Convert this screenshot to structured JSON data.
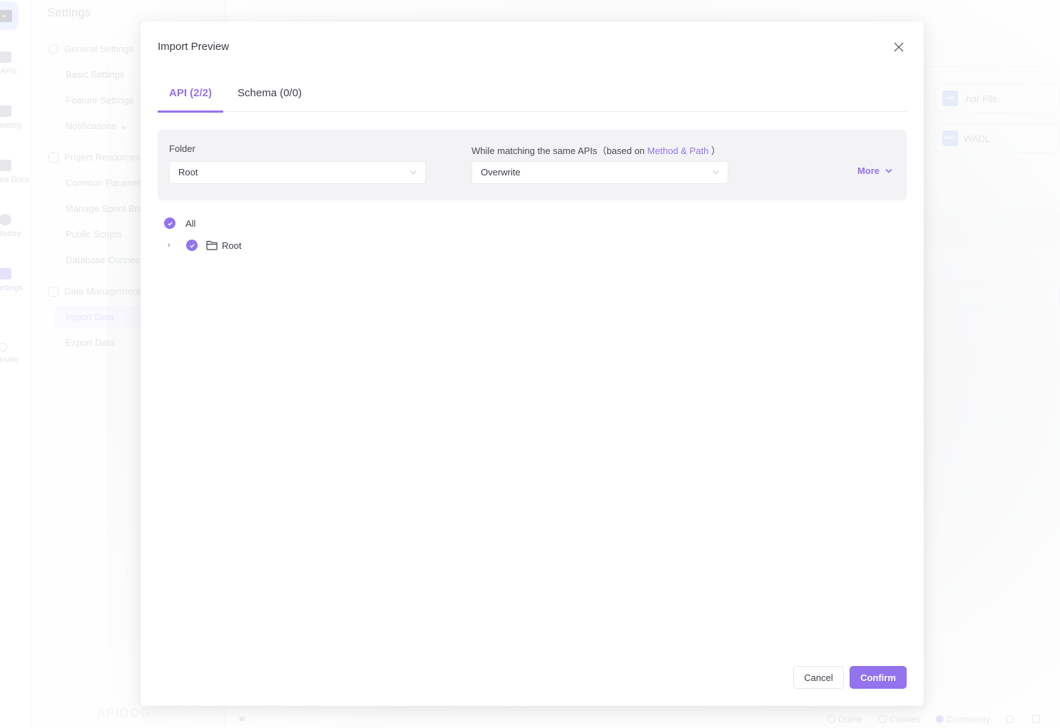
{
  "background": {
    "rail": {
      "items": [
        {
          "label": "APIs",
          "icon": "api-icon"
        },
        {
          "label": "Testing",
          "icon": "testing-icon"
        },
        {
          "label": "Share Docs",
          "icon": "share-docs-icon"
        },
        {
          "label": "History",
          "icon": "history-icon"
        },
        {
          "label": "Settings",
          "icon": "settings-icon",
          "active": true
        },
        {
          "label": "Invite",
          "icon": "invite-icon"
        }
      ]
    },
    "settings_nav": {
      "title": "Settings",
      "groups": [
        {
          "label": "General Settings",
          "icon": "gear-icon",
          "items": [
            "Basic Settings",
            "Feature Settings",
            "Notifications"
          ]
        },
        {
          "label": "Project Resources",
          "icon": "layers-icon",
          "items": [
            "Common Parameters",
            "Manage Sprint Branches",
            "Public Scripts",
            "Database Connections"
          ]
        },
        {
          "label": "Data Management",
          "icon": "database-icon",
          "items": [
            "Import Data",
            "Export Data"
          ]
        }
      ],
      "active_item": "Import Data"
    },
    "brand": "APIDOG",
    "collapse_glyph": "«",
    "import_formats": [
      {
        "badge": ".har",
        "label": ".har File"
      },
      {
        "badge": "WADL",
        "label": "WADL"
      }
    ],
    "status_bar": [
      "Online",
      "Cookies",
      "Community"
    ]
  },
  "modal": {
    "title": "Import Preview",
    "tabs": [
      {
        "label": "API (2/2)",
        "active": true
      },
      {
        "label": "Schema (0/0)",
        "active": false
      }
    ],
    "folder": {
      "label": "Folder",
      "value": "Root"
    },
    "matching": {
      "label": "While matching the same APIs",
      "hint_prefix": "（based on ",
      "hint_highlight": "Method & Path",
      "hint_suffix": " ）",
      "value": "Overwrite"
    },
    "more_label": "More",
    "tree": {
      "all_label": "All",
      "all_checked": true,
      "nodes": [
        {
          "label": "Root",
          "checked": true,
          "expanded": false
        }
      ]
    },
    "cancel_label": "Cancel",
    "confirm_label": "Confirm"
  },
  "colors": {
    "accent": "#9373ee"
  }
}
